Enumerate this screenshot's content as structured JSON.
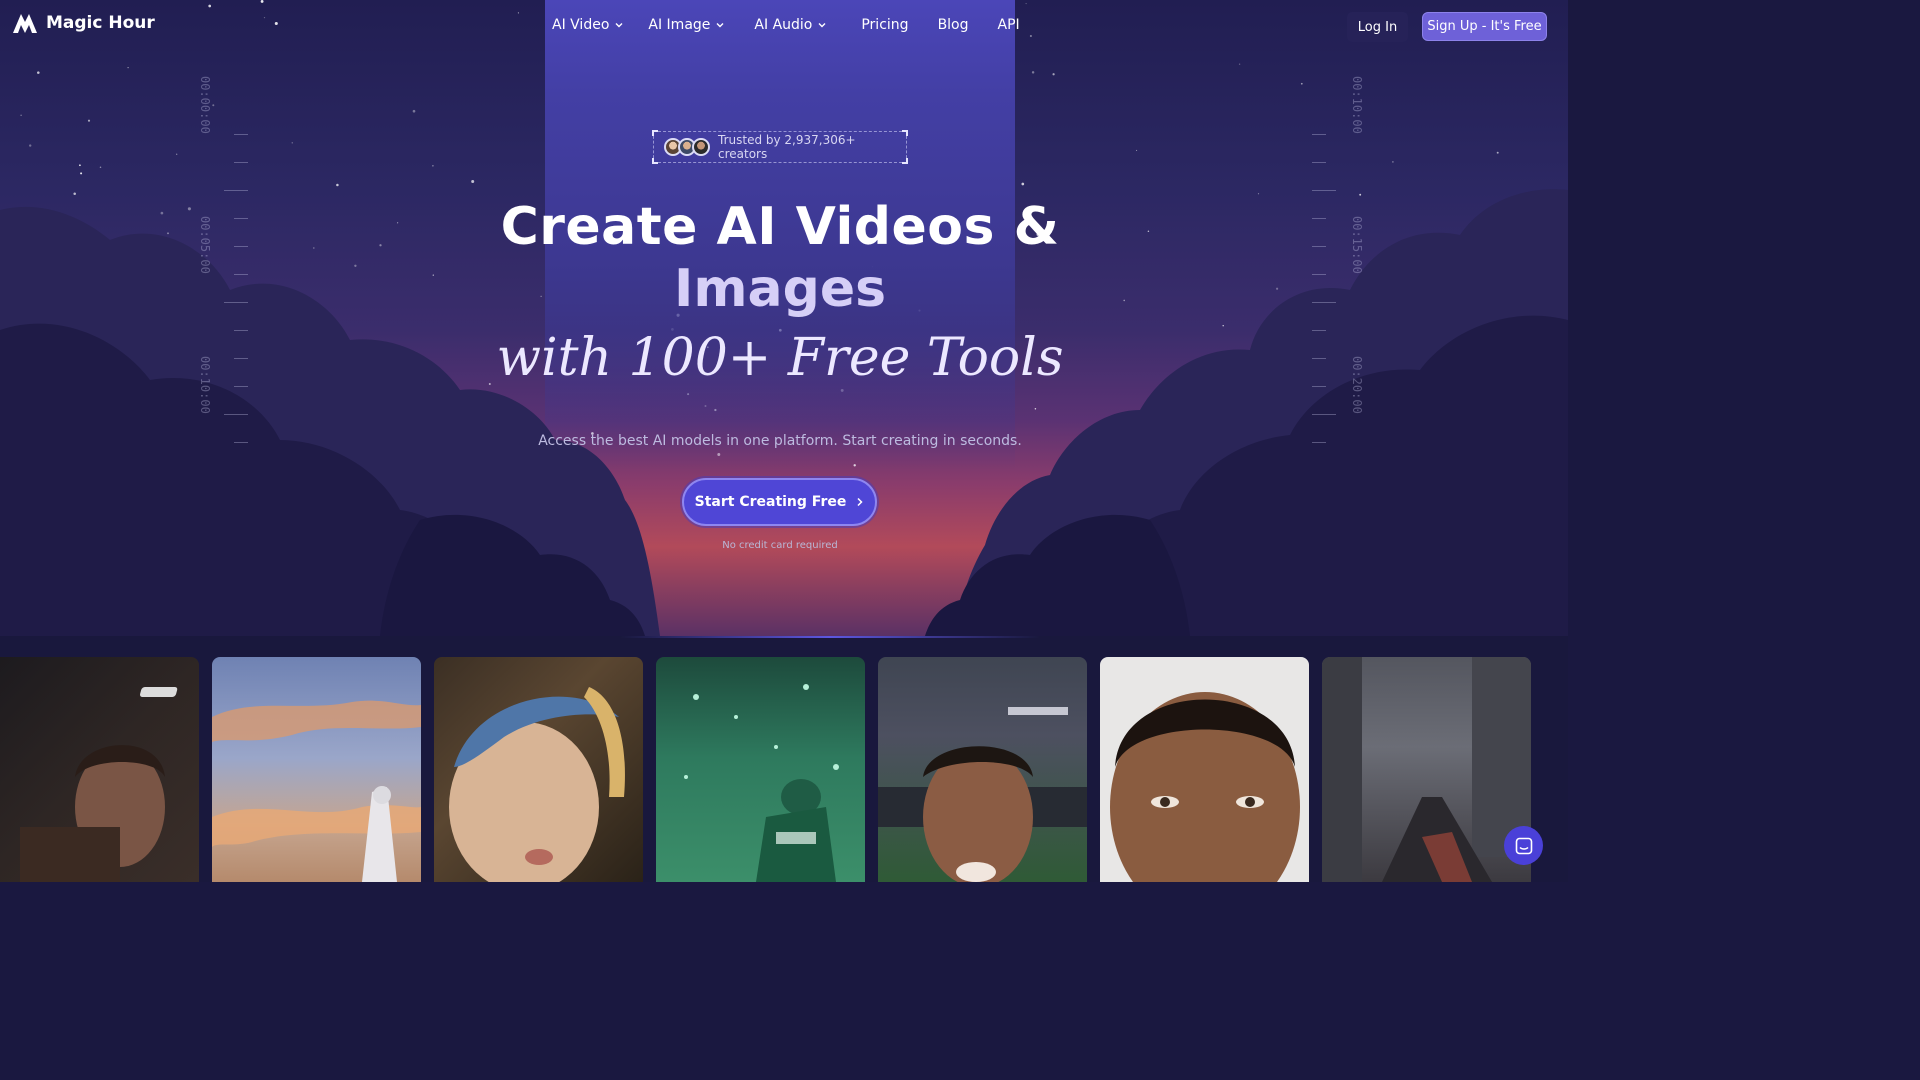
{
  "brand": {
    "name": "Magic Hour",
    "logo_icon": "magic-hour-logo-icon"
  },
  "nav": {
    "items": [
      {
        "label": "AI Video",
        "has_dropdown": true
      },
      {
        "label": "AI Image",
        "has_dropdown": true
      },
      {
        "label": "AI Audio",
        "has_dropdown": true
      },
      {
        "label": "Pricing",
        "has_dropdown": false
      },
      {
        "label": "Blog",
        "has_dropdown": false
      },
      {
        "label": "API",
        "has_dropdown": false
      }
    ],
    "login_label": "Log In",
    "signup_label": "Sign Up  - It's Free"
  },
  "hero": {
    "trust_text": "Trusted by 2,937,306+ creators",
    "title_line1": "Create AI Videos &",
    "title_line2": "Images",
    "title_line3": "with 100+ Free Tools",
    "subtitle": "Access the best AI models in one platform. Start creating in seconds.",
    "cta_label": "Start Creating Free",
    "cta_note": "No credit card required"
  },
  "timeline_left": {
    "labels": [
      "00:00:00",
      "00:05:00",
      "00:10:00"
    ]
  },
  "timeline_right": {
    "labels": [
      "00:10:00",
      "00:15:00",
      "00:20:00"
    ]
  },
  "gallery": {
    "cards": [
      {
        "name": "gallery-card-man-portrait"
      },
      {
        "name": "gallery-card-sky-warrior"
      },
      {
        "name": "gallery-card-pearl-earring"
      },
      {
        "name": "gallery-card-football-player"
      },
      {
        "name": "gallery-card-stadium-selfie"
      },
      {
        "name": "gallery-card-face-closeup"
      },
      {
        "name": "gallery-card-city-street"
      }
    ]
  },
  "colors": {
    "accent": "#4f46d6",
    "signup": "#6e61d8",
    "background": "#1a1840"
  }
}
